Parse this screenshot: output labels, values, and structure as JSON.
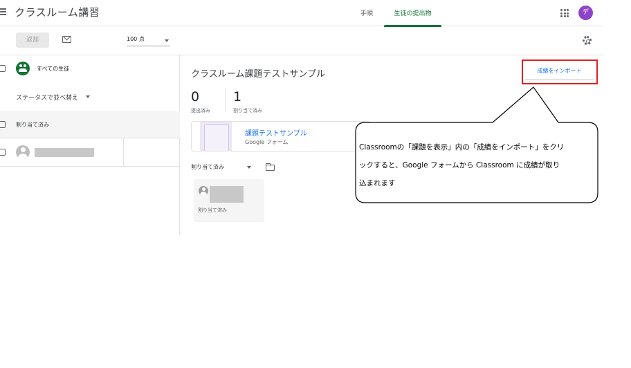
{
  "app": {
    "title": "クラスルーム講習"
  },
  "tabs": [
    {
      "label": "手順",
      "active": false
    },
    {
      "label": "生徒の提出物",
      "active": true
    }
  ],
  "user": {
    "avatar_initial": "デ",
    "avatar_color": "#8e44c8"
  },
  "toolbar": {
    "return_label": "返却",
    "points_value": "100 点",
    "icons": [
      "mail-icon",
      "gear-icon"
    ]
  },
  "sidebar": {
    "all_students_label": "すべての生徒",
    "sort_label": "ステータスで並べ替え",
    "assigned_group_label": "割り当て済み"
  },
  "assignment": {
    "title": "クラスルーム課題テストサンプル",
    "import_label": "成績をインポート",
    "stats": [
      {
        "value": "0",
        "label": "提出済み"
      },
      {
        "value": "1",
        "label": "割り当て済み"
      }
    ],
    "attachment": {
      "title": "課題テストサンプル",
      "type": "Google フォーム"
    },
    "filter_label": "割り当て済み",
    "card_status": "割り当て済み"
  },
  "callout": {
    "line1": "Classroomの「課題を表示」内の「成績をインポート」をクリ",
    "line2": "ックすると、Google フォームから Classroom に成績が取り",
    "line3": "込まれます"
  },
  "colors": {
    "accent_green": "#137333",
    "link_blue": "#1a73e8",
    "highlight_red": "#e02020"
  }
}
